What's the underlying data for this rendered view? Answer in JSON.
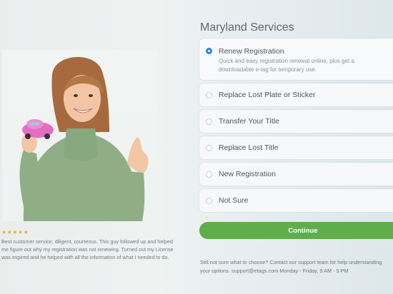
{
  "photo": {
    "alt": "Smiling woman in green sweater holding a pink toy car"
  },
  "review": {
    "stars": "★★★★★",
    "text": "Best customer service, diligent, courteous. This guy followed up and helped me figure out why my registration was not renewing. Turned out my License was expired and he helped with all the information of what I needed to do."
  },
  "title": "Maryland Services",
  "options": [
    {
      "label": "Renew Registration",
      "description": "Quick and easy registration renewal online, plus get a downloadable e-tag for temporary use.",
      "selected": true
    },
    {
      "label": "Replace Lost Plate or Sticker",
      "selected": false
    },
    {
      "label": "Transfer Your Title",
      "selected": false
    },
    {
      "label": "Replace Lost Title",
      "selected": false
    },
    {
      "label": "New Registration",
      "selected": false
    },
    {
      "label": "Not Sure",
      "selected": false
    }
  ],
  "continue_label": "Continue",
  "help_text": "Still not sure what to choose? Contact our support team for help understanding your options. support@etags.com Monday - Friday, 9 AM - 5 PM",
  "colors": {
    "accent_green": "#5fae4c",
    "radio_blue": "#2f80ed"
  }
}
